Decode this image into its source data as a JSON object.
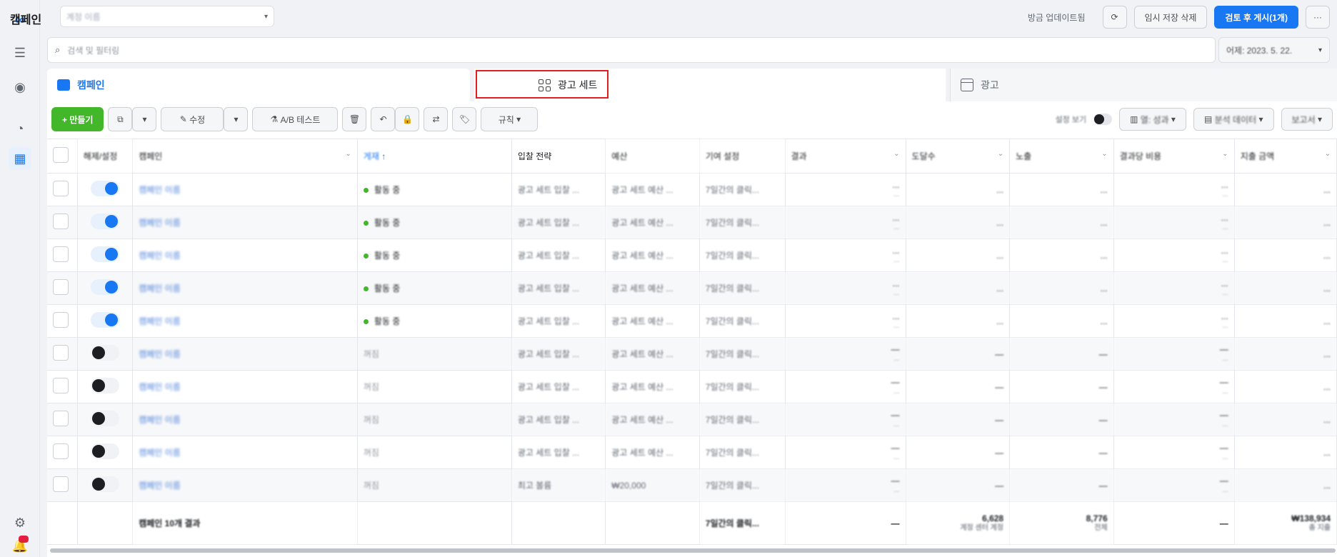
{
  "app": {
    "title": "캠페인",
    "account_name": "계정 이름",
    "recent_update": "방금 업데이트됨",
    "discard_draft": "임시 저장 삭제",
    "review_publish": "검토 후 게시(1개)",
    "search_placeholder": "검색 및 필터링",
    "date_range": "어제: 2023. 5. 22.",
    "brand_color": "#1877f2"
  },
  "tabs": [
    {
      "label": "캠페인"
    },
    {
      "label": "광고 세트"
    },
    {
      "label": "광고"
    }
  ],
  "toolbar": {
    "create": "+ 만들기",
    "edit": "수정",
    "ab_test": "A/B 테스트",
    "rules": "규칙",
    "view_settings": "설정 보기",
    "columns": "열: 성과",
    "breakdown": "분석 데이터",
    "reports": "보고서"
  },
  "table": {
    "headers": [
      "",
      "해제/설정",
      "캠페인",
      "게재",
      "입찰 전략",
      "예산",
      "기여 설정",
      "결과",
      "도달수",
      "노출",
      "결과당 비용",
      "지출 금액"
    ],
    "rows": [
      {
        "on": true,
        "campaign": "캠페인 이름",
        "delivery": "활동 중",
        "active": true,
        "bid": "광고 세트 입찰 ...",
        "budget": "광고 세트 예산 ...",
        "attribution": "7일간의 클릭...",
        "result": "...",
        "result_sub": "...",
        "reach": "...",
        "impressions": "...",
        "cost": "...",
        "cost_sub": "...",
        "spend": "..."
      },
      {
        "on": true,
        "campaign": "캠페인 이름",
        "delivery": "활동 중",
        "active": true,
        "bid": "광고 세트 입찰 ...",
        "budget": "광고 세트 예산 ...",
        "attribution": "7일간의 클릭...",
        "result": "...",
        "result_sub": "...",
        "reach": "...",
        "impressions": "...",
        "cost": "...",
        "cost_sub": "...",
        "spend": "..."
      },
      {
        "on": true,
        "campaign": "캠페인 이름",
        "delivery": "활동 중",
        "active": true,
        "bid": "광고 세트 입찰 ...",
        "budget": "광고 세트 예산 ...",
        "attribution": "7일간의 클릭...",
        "result": "...",
        "result_sub": "...",
        "reach": "...",
        "impressions": "...",
        "cost": "...",
        "cost_sub": "...",
        "spend": "..."
      },
      {
        "on": true,
        "campaign": "캠페인 이름",
        "delivery": "활동 중",
        "active": true,
        "bid": "광고 세트 입찰 ...",
        "budget": "광고 세트 예산 ...",
        "attribution": "7일간의 클릭...",
        "result": "...",
        "result_sub": "...",
        "reach": "...",
        "impressions": "...",
        "cost": "...",
        "cost_sub": "...",
        "spend": "..."
      },
      {
        "on": true,
        "campaign": "캠페인 이름",
        "delivery": "활동 중",
        "active": true,
        "bid": "광고 세트 입찰 ...",
        "budget": "광고 세트 예산 ...",
        "attribution": "7일간의 클릭...",
        "result": "...",
        "result_sub": "...",
        "reach": "...",
        "impressions": "...",
        "cost": "...",
        "cost_sub": "...",
        "spend": "..."
      },
      {
        "on": false,
        "campaign": "캠페인 이름",
        "delivery": "꺼짐",
        "active": false,
        "bid": "광고 세트 입찰 ...",
        "budget": "광고 세트 예산 ...",
        "attribution": "7일간의 클릭...",
        "result": "—",
        "result_sub": "...",
        "reach": "—",
        "impressions": "—",
        "cost": "—",
        "cost_sub": "...",
        "spend": "..."
      },
      {
        "on": false,
        "campaign": "캠페인 이름",
        "delivery": "꺼짐",
        "active": false,
        "bid": "광고 세트 입찰 ...",
        "budget": "광고 세트 예산 ...",
        "attribution": "7일간의 클릭...",
        "result": "—",
        "result_sub": "...",
        "reach": "—",
        "impressions": "—",
        "cost": "—",
        "cost_sub": "...",
        "spend": "..."
      },
      {
        "on": false,
        "campaign": "캠페인 이름",
        "delivery": "꺼짐",
        "active": false,
        "bid": "광고 세트 입찰 ...",
        "budget": "광고 세트 예산 ...",
        "attribution": "7일간의 클릭...",
        "result": "—",
        "result_sub": "...",
        "reach": "—",
        "impressions": "—",
        "cost": "—",
        "cost_sub": "...",
        "spend": "..."
      },
      {
        "on": false,
        "campaign": "캠페인 이름",
        "delivery": "꺼짐",
        "active": false,
        "bid": "광고 세트 입찰 ...",
        "budget": "광고 세트 예산 ...",
        "attribution": "7일간의 클릭...",
        "result": "—",
        "result_sub": "...",
        "reach": "—",
        "impressions": "—",
        "cost": "—",
        "cost_sub": "...",
        "spend": "..."
      },
      {
        "on": false,
        "campaign": "캠페인 이름",
        "delivery": "꺼짐",
        "active": false,
        "bid": "최고 볼륨",
        "budget": "₩20,000",
        "attribution": "7일간의 클릭...",
        "result": "—",
        "result_sub": "...",
        "reach": "—",
        "impressions": "—",
        "cost": "—",
        "cost_sub": "...",
        "spend": "..."
      }
    ],
    "footer": {
      "label": "캠페인 10개 결과",
      "attribution": "7일간의 클릭...",
      "result": "—",
      "reach": "6,628",
      "reach_sub": "계정 센터 계정",
      "impressions": "8,776",
      "impressions_sub": "전체",
      "cost": "—",
      "spend": "₩138,934",
      "spend_sub": "총 지출"
    }
  }
}
